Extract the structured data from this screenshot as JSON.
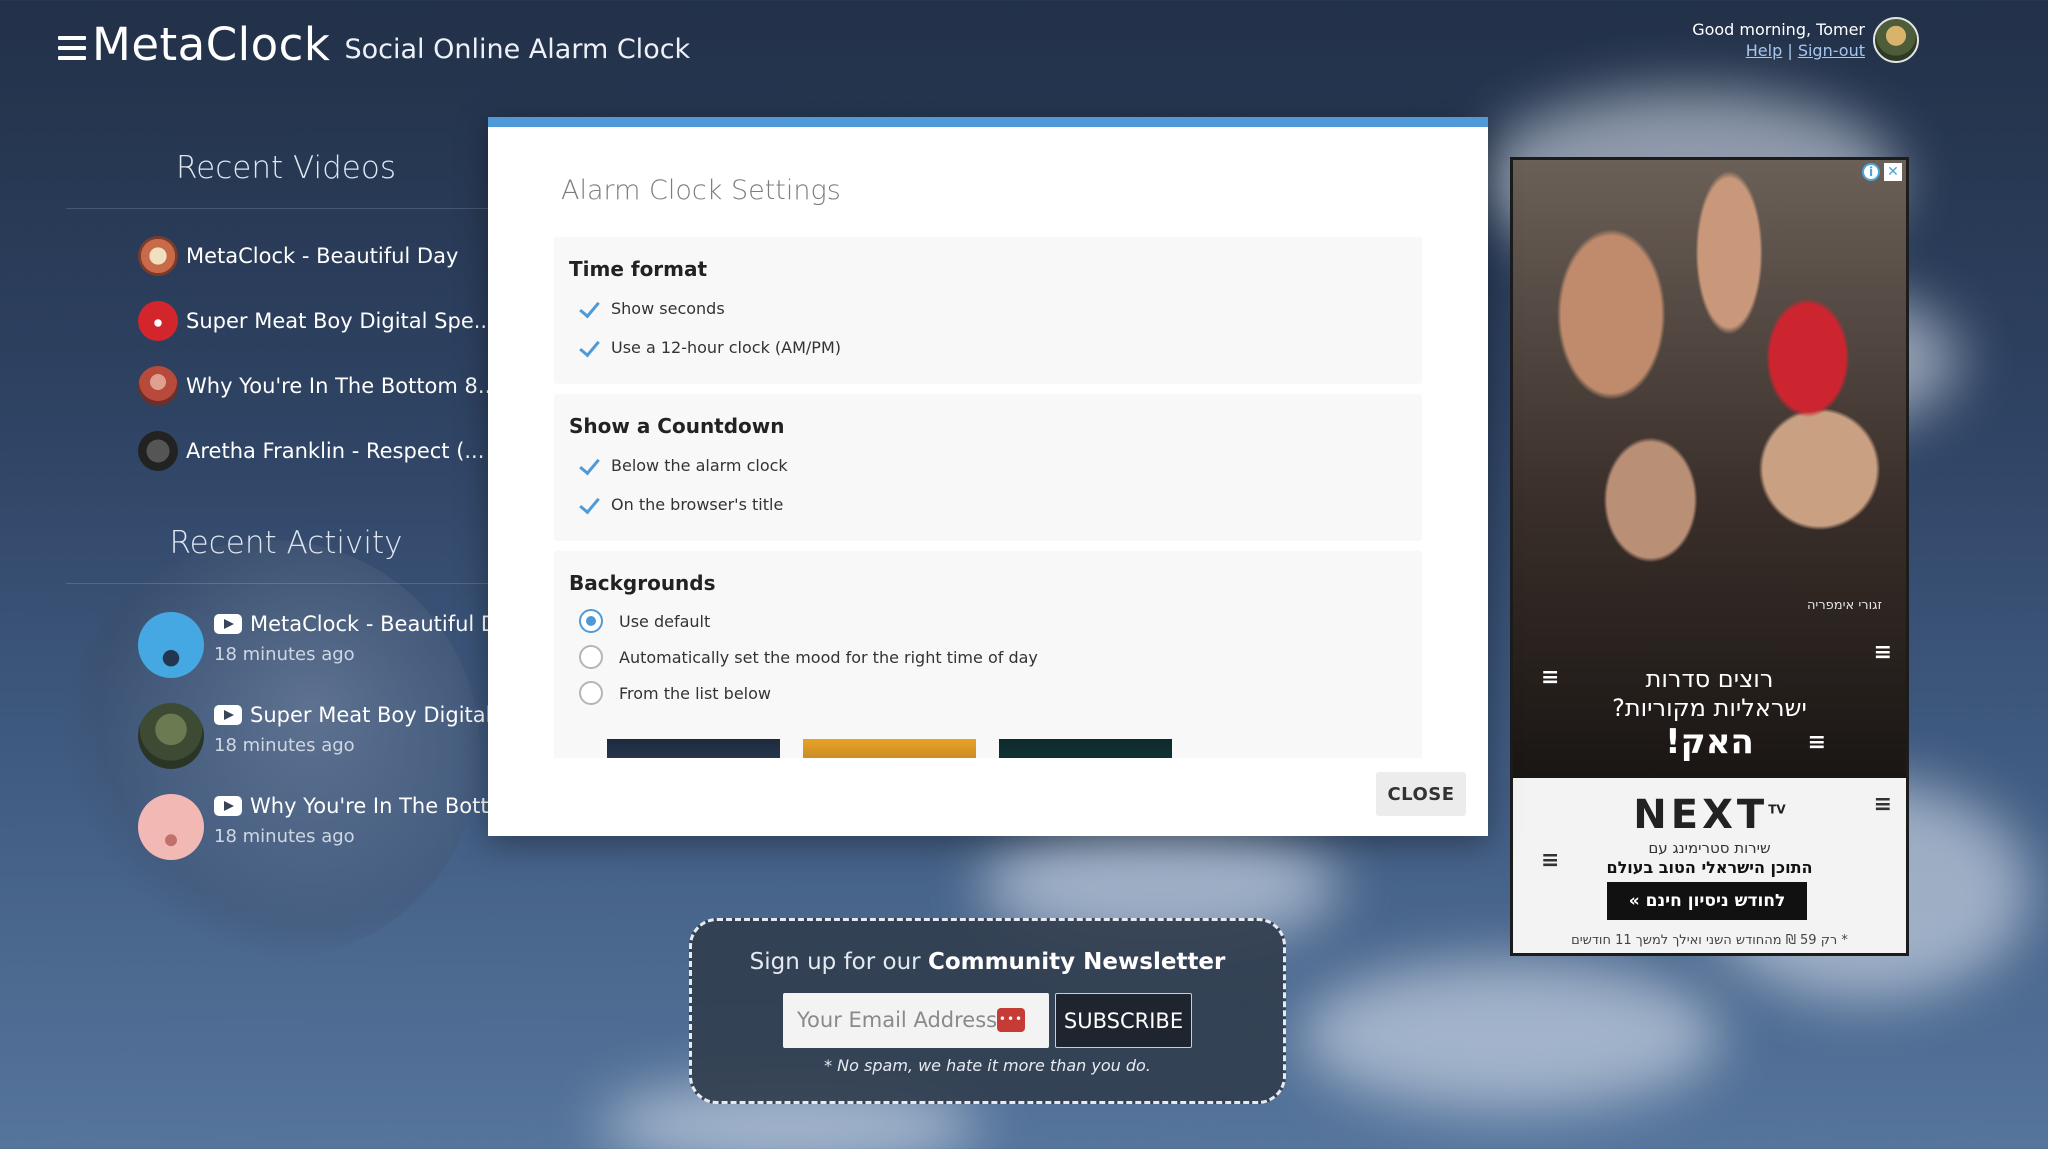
{
  "header": {
    "brand": "MetaClock",
    "tagline": "Social Online Alarm Clock"
  },
  "user": {
    "greeting": "Good morning, Tomer",
    "help_label": "Help",
    "separator": "|",
    "signout_label": "Sign-out"
  },
  "recent_videos": {
    "title": "Recent Videos",
    "items": [
      {
        "title": "MetaClock - Beautiful Day"
      },
      {
        "title": "Super Meat Boy Digital Spe..."
      },
      {
        "title": "Why You're In The Bottom 8..."
      },
      {
        "title": "Aretha Franklin - Respect (..."
      }
    ]
  },
  "recent_activity": {
    "title": "Recent Activity",
    "items": [
      {
        "title": "MetaClock - Beautiful Da",
        "time": "18 minutes ago"
      },
      {
        "title": "Super Meat Boy Digital S",
        "time": "18 minutes ago"
      },
      {
        "title": "Why You're In The Bottor",
        "time": "18 minutes ago"
      }
    ]
  },
  "modal": {
    "title": "Alarm Clock Settings",
    "time_format": {
      "heading": "Time format",
      "options": [
        {
          "label": "Show seconds",
          "checked": true
        },
        {
          "label": "Use a 12-hour clock (AM/PM)",
          "checked": true
        }
      ]
    },
    "countdown": {
      "heading": "Show a Countdown",
      "options": [
        {
          "label": "Below the alarm clock",
          "checked": true
        },
        {
          "label": "On the browser's title",
          "checked": true
        }
      ]
    },
    "backgrounds": {
      "heading": "Backgrounds",
      "options": [
        {
          "label": "Use default",
          "selected": true
        },
        {
          "label": "Automatically set the mood for the right time of day",
          "selected": false
        },
        {
          "label": "From the list below",
          "selected": false
        }
      ]
    },
    "close_label": "CLOSE"
  },
  "ad": {
    "photo_credit": "זגורי אימפריה",
    "headline_line1": "רוצים סדרות",
    "headline_line2": "ישראליות מקוריות?",
    "headline_big": "האק!",
    "logo": "NEXT",
    "logo_suffix": "TV",
    "sub1": "שירות סטרימינג עם",
    "sub2": "התוכן הישראלי הטוב בעולם",
    "cta": "לחודש ניסיון חינם »",
    "fine_print": "* רק 59 ₪ מהחודש השני ואילך למשך 11 חודשים"
  },
  "newsletter": {
    "title_prefix": "Sign up for our",
    "title_bold": "Community Newsletter",
    "email_placeholder": "Your Email Address",
    "subscribe_label": "SUBSCRIBE",
    "note": "* No spam, we hate it more than you do."
  },
  "colors": {
    "accent": "#4f9ad6",
    "modal_bg": "#ffffff",
    "card_bg": "#f8f8f8",
    "newsletter_bg": "#323e50"
  }
}
